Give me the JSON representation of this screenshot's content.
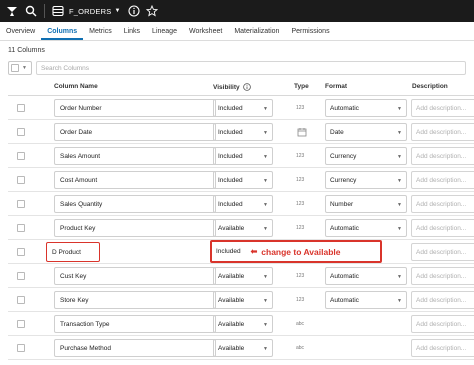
{
  "header": {
    "title": "F_ORDERS",
    "icons": [
      "logo-icon",
      "search-icon",
      "dataset-icon",
      "info-icon",
      "star-icon"
    ]
  },
  "tabs": [
    {
      "label": "Overview",
      "active": false
    },
    {
      "label": "Columns",
      "active": true
    },
    {
      "label": "Metrics",
      "active": false
    },
    {
      "label": "Links",
      "active": false
    },
    {
      "label": "Lineage",
      "active": false
    },
    {
      "label": "Worksheet",
      "active": false
    },
    {
      "label": "Materialization",
      "active": false
    },
    {
      "label": "Permissions",
      "active": false
    }
  ],
  "columns_count": "11 Columns",
  "search": {
    "placeholder": "Search Columns"
  },
  "table": {
    "headers": {
      "name": "Column Name",
      "visibility": "Visibility",
      "type": "Type",
      "format": "Format",
      "description": "Description"
    },
    "description_placeholder": "Add description...",
    "rows": [
      {
        "name": "Order Number",
        "visibility": "Included",
        "type": "123",
        "format": "Automatic"
      },
      {
        "name": "Order Date",
        "visibility": "Included",
        "type": "calendar-icon",
        "format": "Date"
      },
      {
        "name": "Sales Amount",
        "visibility": "Included",
        "type": "123",
        "format": "Currency"
      },
      {
        "name": "Cost Amount",
        "visibility": "Included",
        "type": "123",
        "format": "Currency"
      },
      {
        "name": "Sales Quantity",
        "visibility": "Included",
        "type": "123",
        "format": "Number"
      },
      {
        "name": "Product Key",
        "visibility": "Available",
        "type": "123",
        "format": "Automatic"
      },
      {
        "name": "D Product",
        "visibility": "Included",
        "type": "",
        "format": "",
        "annotation": "change to Available"
      },
      {
        "name": "Cust Key",
        "visibility": "Available",
        "type": "123",
        "format": "Automatic"
      },
      {
        "name": "Store Key",
        "visibility": "Available",
        "type": "123",
        "format": "Automatic"
      },
      {
        "name": "Transaction Type",
        "visibility": "Available",
        "type": "abc",
        "format": ""
      },
      {
        "name": "Purchase Method",
        "visibility": "Available",
        "type": "abc",
        "format": ""
      }
    ]
  },
  "colors": {
    "accent": "#0f6fb2",
    "annotation": "#d9342b",
    "topbar": "#1b1b1b"
  }
}
